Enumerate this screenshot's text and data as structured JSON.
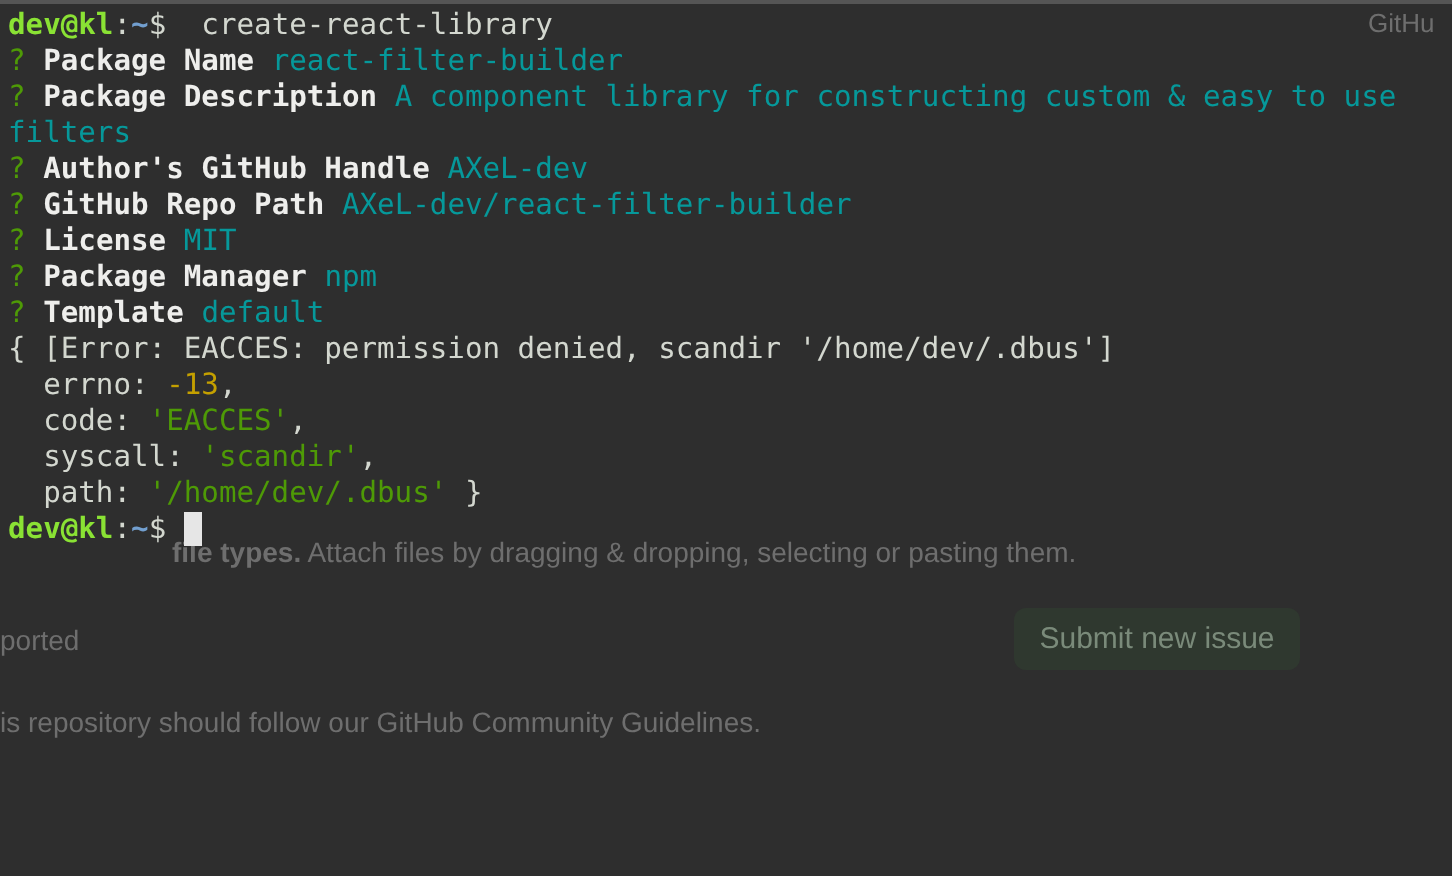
{
  "terminal": {
    "lines": [
      [
        {
          "kind": "user",
          "text": "dev@kl"
        },
        {
          "kind": "plain",
          "text": ":"
        },
        {
          "kind": "path",
          "text": "~"
        },
        {
          "kind": "plain",
          "text": "$  create-react-library"
        }
      ],
      [
        {
          "kind": "question",
          "text": "?"
        },
        {
          "kind": "label",
          "text": "Package Name"
        },
        {
          "kind": "answer",
          "text": "react-filter-builder"
        }
      ],
      [
        {
          "kind": "question",
          "text": "?"
        },
        {
          "kind": "label",
          "text": "Package Description"
        },
        {
          "kind": "answer",
          "text": "A component library for constructing custom & easy to use"
        }
      ],
      [
        {
          "kind": "answer",
          "text": "filters"
        }
      ],
      [
        {
          "kind": "question",
          "text": "?"
        },
        {
          "kind": "label",
          "text": "Author's GitHub Handle"
        },
        {
          "kind": "answer",
          "text": "AXeL-dev"
        }
      ],
      [
        {
          "kind": "question",
          "text": "?"
        },
        {
          "kind": "label",
          "text": "GitHub Repo Path"
        },
        {
          "kind": "answer",
          "text": "AXeL-dev/react-filter-builder"
        }
      ],
      [
        {
          "kind": "question",
          "text": "?"
        },
        {
          "kind": "label",
          "text": "License"
        },
        {
          "kind": "answer",
          "text": "MIT"
        }
      ],
      [
        {
          "kind": "question",
          "text": "?"
        },
        {
          "kind": "label",
          "text": "Package Manager"
        },
        {
          "kind": "answer",
          "text": "npm"
        }
      ],
      [
        {
          "kind": "question",
          "text": "?"
        },
        {
          "kind": "label",
          "text": "Template"
        },
        {
          "kind": "answer",
          "text": "default"
        }
      ],
      [
        {
          "kind": "plain",
          "text": "{ [Error: EACCES: permission denied, scandir '/home/dev/.dbus']"
        }
      ],
      [
        {
          "kind": "plain",
          "text": "  errno: "
        },
        {
          "kind": "number",
          "text": "-13"
        },
        {
          "kind": "plain",
          "text": ","
        }
      ],
      [
        {
          "kind": "plain",
          "text": "  code: "
        },
        {
          "kind": "string",
          "text": "'EACCES'"
        },
        {
          "kind": "plain",
          "text": ","
        }
      ],
      [
        {
          "kind": "plain",
          "text": "  syscall: "
        },
        {
          "kind": "string",
          "text": "'scandir'"
        },
        {
          "kind": "plain",
          "text": ","
        }
      ],
      [
        {
          "kind": "plain",
          "text": "  path: "
        },
        {
          "kind": "string",
          "text": "'/home/dev/.dbus'"
        },
        {
          "kind": "plain",
          "text": " }"
        }
      ],
      [
        {
          "kind": "user",
          "text": "dev@kl"
        },
        {
          "kind": "plain",
          "text": ":"
        },
        {
          "kind": "path",
          "text": "~"
        },
        {
          "kind": "plain",
          "text": "$ "
        },
        {
          "kind": "cursor"
        }
      ]
    ]
  },
  "page_behind": {
    "corner_text": "GitHu",
    "attach_hint": "**file types.** Attach files by dragging & dropping, selecting or pasting them.",
    "side_text": "ported",
    "submit_button": "Submit new issue",
    "guidelines": "is repository should follow our GitHub Community Guidelines."
  }
}
